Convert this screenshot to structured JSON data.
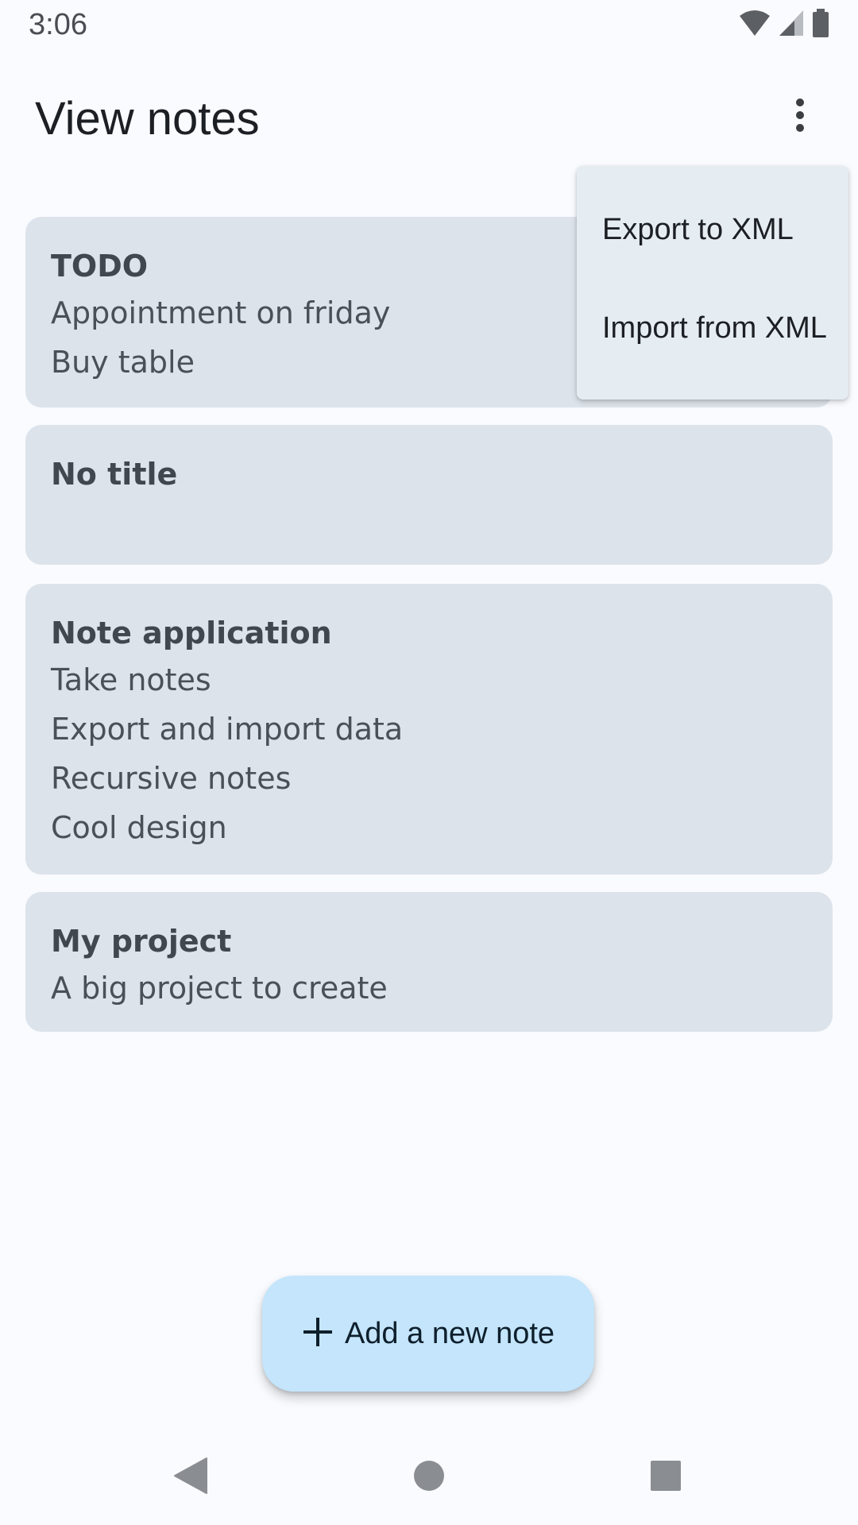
{
  "status_bar": {
    "time": "3:06",
    "icons": [
      "wifi-icon",
      "cellular-signal-icon",
      "battery-icon"
    ]
  },
  "app_bar": {
    "title": "View notes",
    "overflow_icon": "more-vert-icon"
  },
  "notes": [
    {
      "title": "TODO",
      "lines": [
        "Appointment on friday",
        "Buy table"
      ]
    },
    {
      "title": "No title",
      "lines": []
    },
    {
      "title": "Note application",
      "lines": [
        "Take notes",
        "Export and import data",
        "Recursive notes",
        "Cool design"
      ]
    },
    {
      "title": "My project",
      "lines": [
        "A big project to create"
      ]
    }
  ],
  "overflow_menu": {
    "items": [
      {
        "label": "Export to XML"
      },
      {
        "label": "Import from XML"
      }
    ]
  },
  "fab": {
    "icon": "plus-icon",
    "label": "Add a new note"
  },
  "navigation": {
    "icons": [
      "back-icon",
      "home-icon",
      "recents-icon"
    ]
  },
  "colors": {
    "background": "#f9fbff",
    "card": "#dde3ea",
    "menu": "#e6edf2",
    "fab": "#c4e5fb"
  }
}
